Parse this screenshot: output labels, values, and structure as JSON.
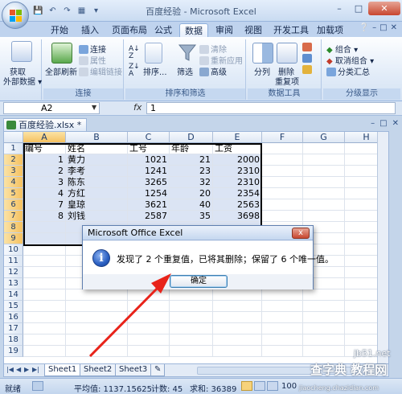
{
  "window": {
    "title": "百度经验 - Microsoft Excel",
    "controls": [
      "–",
      "□",
      "✕"
    ]
  },
  "ribbon": {
    "tabs": [
      "开始",
      "插入",
      "页面布局",
      "公式",
      "数据",
      "审阅",
      "视图",
      "开发工具",
      "加载项"
    ],
    "active_tab": "数据",
    "groups": {
      "external": {
        "button": "获取\n外部数据",
        "button_line1": "获取",
        "button_line2": "外部数据 ▾",
        "label": ""
      },
      "connections": {
        "refresh_all": "全部刷新",
        "connections": "连接",
        "properties": "属性",
        "edit_links": "编辑链接",
        "label": "连接"
      },
      "sort_filter": {
        "sort": "排序...",
        "filter": "筛选",
        "clear": "清除",
        "reapply": "重新应用",
        "advanced": "高级",
        "label": "排序和筛选"
      },
      "data_tools": {
        "text_to_columns": "分列",
        "remove_duplicates_line1": "删除",
        "remove_duplicates_line2": "重复项",
        "label": "数据工具"
      },
      "outline": {
        "group": "组合",
        "ungroup": "取消组合",
        "subtotal": "分类汇总",
        "label": "分级显示"
      }
    }
  },
  "formula_bar": {
    "name_box": "A2",
    "fx": "fx",
    "content": "1"
  },
  "workbook": {
    "tab_label": "百度经验.xlsx *",
    "controls": [
      "–",
      "□",
      "✕"
    ]
  },
  "sheet": {
    "columns": [
      "A",
      "B",
      "C",
      "D",
      "E",
      "F",
      "G",
      "H"
    ],
    "rows": [
      "1",
      "2",
      "3",
      "4",
      "5",
      "6",
      "7",
      "8",
      "9",
      "10",
      "11",
      "12",
      "13",
      "14",
      "15",
      "16",
      "17",
      "18",
      "19"
    ],
    "header": [
      "编号",
      "姓名",
      "工号",
      "年龄",
      "工资"
    ],
    "data": [
      [
        "1",
        "黄力",
        "1021",
        "21",
        "2000"
      ],
      [
        "2",
        "李考",
        "1241",
        "23",
        "2310"
      ],
      [
        "3",
        "陈东",
        "3265",
        "32",
        "2310"
      ],
      [
        "4",
        "方红",
        "1254",
        "20",
        "2354"
      ],
      [
        "7",
        "皇琼",
        "3621",
        "40",
        "2563"
      ],
      [
        "8",
        "刘钱",
        "2587",
        "35",
        "3698"
      ]
    ]
  },
  "sheet_tabs": [
    "Sheet1",
    "Sheet2",
    "Sheet3"
  ],
  "active_sheet": "Sheet1",
  "status_bar": {
    "mode": "就绪",
    "average": "平均值: 1137.15625",
    "count": "计数: 45",
    "sum": "求和: 36389",
    "zoom": "100"
  },
  "dialog": {
    "title": "Microsoft Office Excel",
    "message": "发现了 2 个重复值，已将其删除；保留了 6 个唯一值。",
    "ok": "确定",
    "close": "x"
  },
  "watermark": {
    "line1": "查字典 教程网",
    "line2": "jb51.net",
    "line3": "jiaocheng.chazidian.com"
  }
}
